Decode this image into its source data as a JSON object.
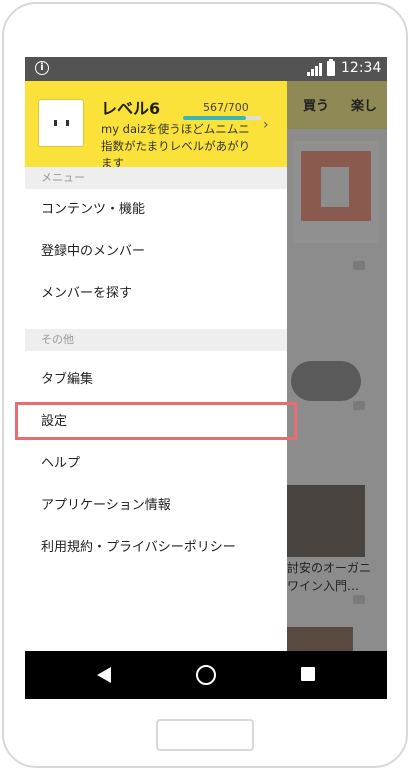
{
  "status_bar": {
    "time": "12:34",
    "info_icon": "i"
  },
  "background_app": {
    "tabs": [
      "買う",
      "楽し"
    ],
    "article_lines": [
      "討安のオーガニ",
      "ワイン入門…"
    ]
  },
  "drawer": {
    "header": {
      "level_title": "レベル6",
      "progress_text": "567/700",
      "progress_value": 567,
      "progress_max": 700,
      "description": "my daizを使うほどムニムニ指数がたまりレベルがあがります",
      "chevron_icon": "chevron-right-icon"
    },
    "sections": [
      {
        "label": "メニュー",
        "items": [
          "コンテンツ・機能",
          "登録中のメンバー",
          "メンバーを探す"
        ]
      },
      {
        "label": "その他",
        "items": [
          "タブ編集",
          "設定",
          "ヘルプ",
          "アプリケーション情報",
          "利用規約・プライバシーポリシー"
        ]
      }
    ]
  },
  "highlight": {
    "target": "設定",
    "color": "#e86c72"
  },
  "colors": {
    "header_yellow": "#fbe23b",
    "progress_teal": "#3bb7b3",
    "status_bar": "#535353"
  }
}
